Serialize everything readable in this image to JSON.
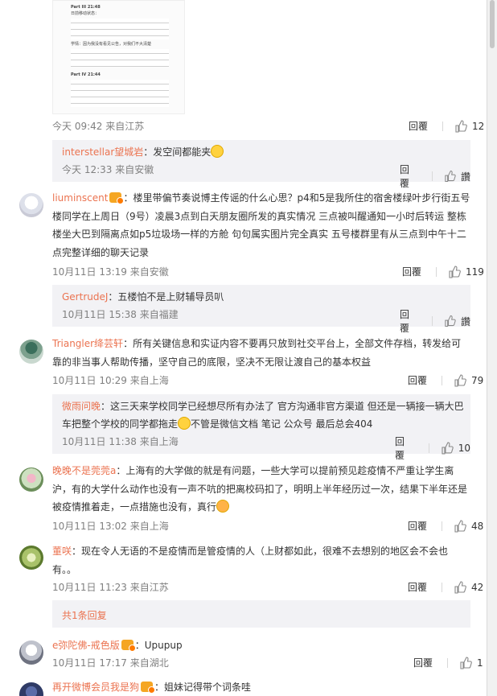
{
  "top_image": {
    "lines": [
      "Part III 21:48",
      "日前移动状态：",
      "学情：因为我没有看见公告，对我们不大清楚",
      "学生：",
      "Part IV 21:44",
      "..."
    ]
  },
  "actions": {
    "reply": "回覆",
    "like": "讚"
  },
  "comments": [
    {
      "id": "top",
      "time_loc": "今天 09:42 来自江苏",
      "likes": "12"
    },
    {
      "id": "sub1",
      "user": "interstellar望城岩",
      "text": "：发空间都能夹",
      "time_loc": "今天 12:33 来自安徽"
    },
    {
      "id": "c1",
      "user": "liuminscent",
      "text": "：楼里带偏节奏说博主传谣的什么心思？p4和5是我所住的宿舍楼绿叶步行街五号楼同学在上周日（9号）凌晨3点到白天朋友圈所发的真实情况 三点被叫醒通知一小时后转运 整栋楼坐大巴到隔离点如p5垃圾场一样的方舱 句句属实图片完全真实 五号楼群里有从三点到中午十二点完整详细的聊天记录",
      "time_loc": "10月11日 13:19 来自安徽",
      "likes": "119"
    },
    {
      "id": "sub2",
      "user": "GertrudeJ",
      "text": "：五楼怕不是上财辅导员叭",
      "time_loc": "10月11日 15:38 来自福建"
    },
    {
      "id": "c2",
      "user": "Triangler绛芸轩",
      "text": "：所有关键信息和实证内容不要再只放到社交平台上，全部文件存档，转发给可靠的非当事人帮助传播，坚守自己的底限，坚决不无限让渡自己的基本权益",
      "time_loc": "10月11日 10:29 来自上海",
      "likes": "79"
    },
    {
      "id": "sub3",
      "user": "微雨问晚",
      "text": "：这三天来学校同学已经想尽所有办法了 官方沟通非官方渠道 但还是一辆接一辆大巴车把整个学校的同学都拖走",
      "text2": "不管是微信文档 笔记 公众号 最后总会404",
      "time_loc": "10月11日 11:38 来自上海",
      "likes": "10"
    },
    {
      "id": "c3",
      "user": "晚晚不是莞莞a",
      "text": "：上海有的大学做的就是有问题，一些大学可以提前预见趁疫情不严重让学生离沪，有的大学什么动作也没有一声不吭的把离校码扣了，明明上半年经历过一次，结果下半年还是被疫情推着走，一点措施也没有，真行",
      "time_loc": "10月11日 13:02 来自上海",
      "likes": "48"
    },
    {
      "id": "c4",
      "user": "董咲",
      "text": "：现在令人无语的不是疫情而是管疫情的人（上财都如此，很难不去想别的地区会不会也有。。",
      "time_loc": "10月11日 11:23 来自江苏",
      "likes": "42"
    },
    {
      "id": "more",
      "label": "共1条回复"
    },
    {
      "id": "c5",
      "user": "e弥陀佛-戒色版",
      "text": "：Upupup",
      "time_loc": "10月11日 17:17 来自湖北",
      "likes": "1"
    },
    {
      "id": "c6",
      "user": "再开微博会员我是狗",
      "text": "：姐妹记得带个词条哇"
    }
  ]
}
